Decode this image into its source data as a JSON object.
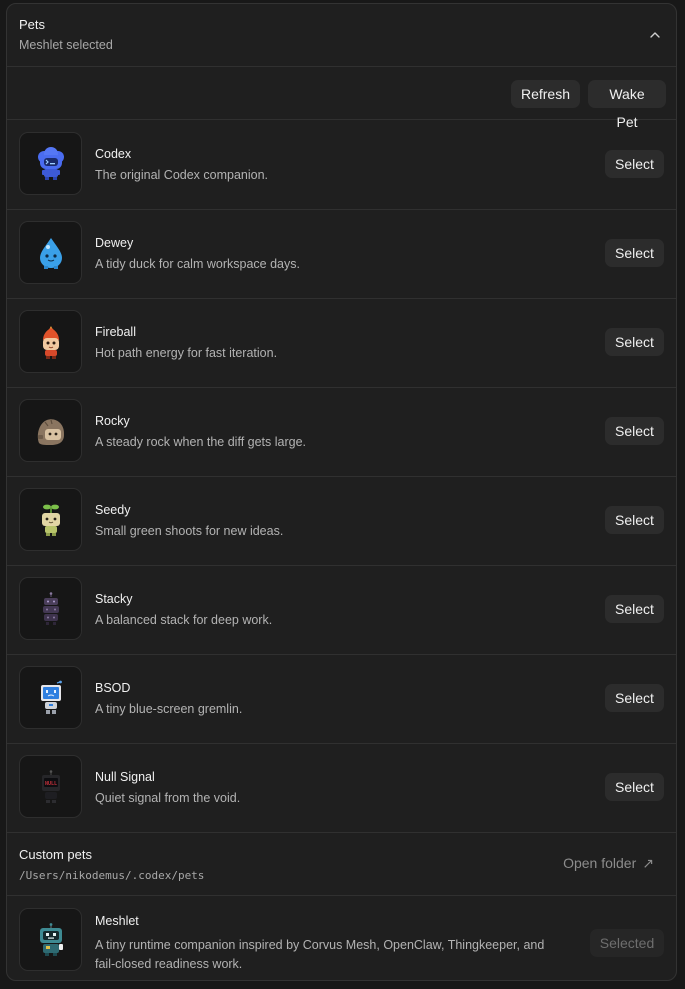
{
  "header": {
    "title": "Pets",
    "subtitle": "Meshlet selected",
    "collapse_icon": "chevron-up-icon"
  },
  "actions": {
    "refresh_label": "Refresh",
    "wake_label": "Wake Pet"
  },
  "pets": [
    {
      "name": "Codex",
      "description": "The original Codex companion.",
      "select_label": "Select",
      "icon": "codex-robot-icon",
      "color": "#4a6cf0"
    },
    {
      "name": "Dewey",
      "description": "A tidy duck for calm workspace days.",
      "select_label": "Select",
      "icon": "water-drop-icon",
      "color": "#3aa0e8"
    },
    {
      "name": "Fireball",
      "description": "Hot path energy for fast iteration.",
      "select_label": "Select",
      "icon": "fireball-icon",
      "color": "#e0522a"
    },
    {
      "name": "Rocky",
      "description": "A steady rock when the diff gets large.",
      "select_label": "Select",
      "icon": "rock-icon",
      "color": "#8a7560"
    },
    {
      "name": "Seedy",
      "description": "Small green shoots for new ideas.",
      "select_label": "Select",
      "icon": "seedling-icon",
      "color": "#d8cf9a"
    },
    {
      "name": "Stacky",
      "description": "A balanced stack for deep work.",
      "select_label": "Select",
      "icon": "stack-icon",
      "color": "#4a3e5a"
    },
    {
      "name": "BSOD",
      "description": "A tiny blue-screen gremlin.",
      "select_label": "Select",
      "icon": "monitor-robot-icon",
      "color": "#2f7fe0"
    },
    {
      "name": "Null Signal",
      "description": "Quiet signal from the void.",
      "select_label": "Select",
      "icon": "null-signal-icon",
      "color": "#c0303a",
      "screen_text": "NULL"
    }
  ],
  "custom": {
    "title": "Custom pets",
    "path": "/Users/nikodemus/.codex/pets",
    "open_folder_label": "Open folder",
    "open_icon": "external-arrow-icon"
  },
  "meshlet": {
    "name": "Meshlet",
    "description_line1": "A tiny runtime companion inspired by Corvus Mesh, OpenClaw, Thingkeeper, and",
    "description_line2": "fail-closed readiness work.",
    "selected_label": "Selected",
    "icon": "meshlet-robot-icon",
    "color": "#3e8a92"
  }
}
